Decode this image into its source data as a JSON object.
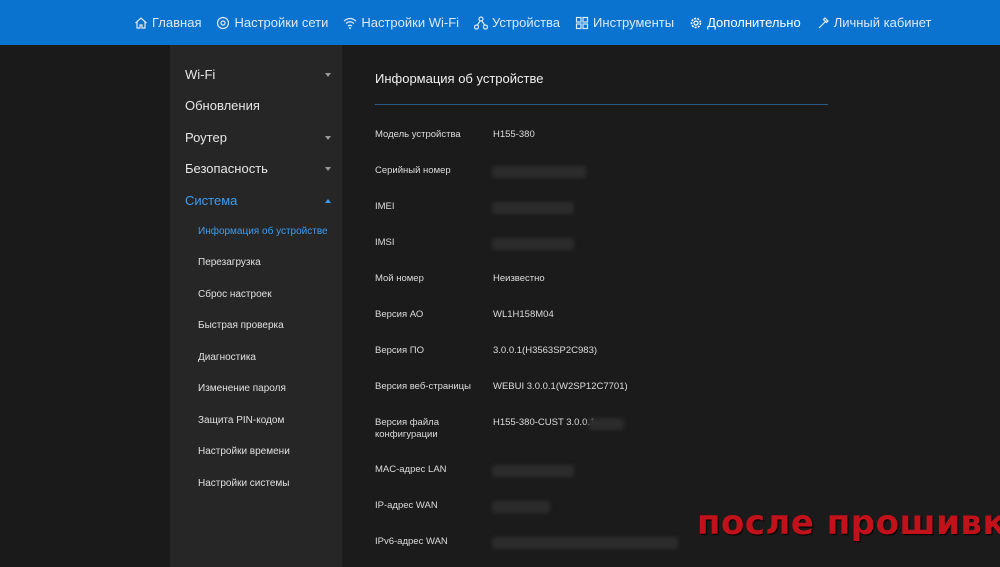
{
  "nav": {
    "home": "Главная",
    "network": "Настройки сети",
    "wifi": "Настройки Wi-Fi",
    "devices": "Устройства",
    "tools": "Инструменты",
    "advanced": "Дополнительно",
    "account": "Личный кабинет"
  },
  "sidebar": {
    "wifi": "Wi-Fi",
    "updates": "Обновления",
    "router": "Роутер",
    "security": "Безопасность",
    "system": "Система",
    "sub": {
      "device_info": "Информация об устройстве",
      "reboot": "Перезагрузка",
      "reset": "Сброс настроек",
      "quick_check": "Быстрая проверка",
      "diagnostics": "Диагностика",
      "change_password": "Изменение пароля",
      "pin_protection": "Защита PIN-кодом",
      "time_settings": "Настройки времени",
      "system_settings": "Настройки системы"
    }
  },
  "main": {
    "title": "Информация об устройстве",
    "rows": [
      {
        "label": "Модель устройства",
        "value": "H155-380"
      },
      {
        "label": "Серийный номер",
        "value": ""
      },
      {
        "label": "IMEI",
        "value": ""
      },
      {
        "label": "IMSI",
        "value": ""
      },
      {
        "label": "Мой номер",
        "value": "Неизвестно"
      },
      {
        "label": "Версия АО",
        "value": "WL1H158M04"
      },
      {
        "label": "Версия ПО",
        "value": "3.0.0.1(H3563SP2C983)"
      },
      {
        "label": "Версия веб-страницы",
        "value": "WEBUI 3.0.0.1(W2SP12C7701)"
      },
      {
        "label": "Версия файла конфигурации",
        "value": "H155-380-CUST 3.0.0.1"
      },
      {
        "label": "MAC-адрес LAN",
        "value": ""
      },
      {
        "label": "IP-адрес WAN",
        "value": ""
      },
      {
        "label": "IPv6-адрес WAN",
        "value": ""
      }
    ]
  },
  "watermark": "после прошивки",
  "colors": {
    "topbar": "#0a72cf",
    "accent": "#3d9cf0",
    "watermark": "#c1121b"
  },
  "icons": [
    "home-icon",
    "network-settings-icon",
    "wifi-icon",
    "devices-icon",
    "tools-icon",
    "gear-icon",
    "user-icon"
  ]
}
